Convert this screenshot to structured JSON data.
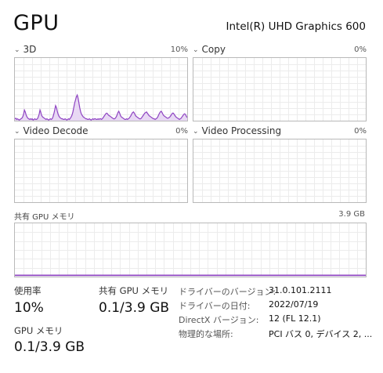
{
  "header": {
    "title": "GPU",
    "adapter_name": "Intel(R) UHD Graphics 600"
  },
  "engines": [
    {
      "label": "3D",
      "percent": "10%",
      "series": [
        3,
        4,
        2,
        3,
        2,
        1,
        2,
        3,
        4,
        6,
        10,
        17,
        14,
        9,
        6,
        4,
        3,
        2,
        3,
        2,
        3,
        1,
        2,
        3,
        2,
        2,
        3,
        6,
        10,
        17,
        13,
        8,
        6,
        5,
        4,
        3,
        2,
        3,
        2,
        1,
        2,
        3,
        2,
        3,
        6,
        11,
        17,
        24,
        21,
        15,
        10,
        7,
        5,
        4,
        3,
        3,
        2,
        2,
        3,
        2,
        1,
        2,
        3,
        2,
        4,
        6,
        9,
        14,
        21,
        28,
        33,
        38,
        41,
        36,
        28,
        20,
        14,
        10,
        8,
        6,
        5,
        4,
        3,
        3,
        2,
        2,
        3,
        2,
        1,
        2,
        3,
        2,
        3,
        3,
        2,
        2,
        3,
        2,
        3,
        3,
        2,
        3,
        5,
        7,
        9,
        11,
        12,
        11,
        9,
        8,
        7,
        6,
        5,
        4,
        3,
        3,
        4,
        6,
        9,
        13,
        15,
        12,
        8,
        6,
        5,
        4,
        3,
        2,
        2,
        3,
        2,
        3,
        4,
        6,
        8,
        11,
        13,
        14,
        12,
        9,
        7,
        6,
        5,
        4,
        3,
        3,
        4,
        6,
        8,
        10,
        12,
        13,
        14,
        12,
        10,
        8,
        7,
        6,
        5,
        4,
        3,
        3,
        2,
        3,
        4,
        6,
        9,
        12,
        14,
        15,
        13,
        10,
        8,
        7,
        6,
        5,
        4,
        4,
        5,
        6,
        8,
        10,
        12,
        12,
        10,
        8,
        6,
        5,
        4,
        3,
        2,
        3,
        4,
        6,
        8,
        10,
        11,
        10,
        7,
        5
      ]
    },
    {
      "label": "Copy",
      "percent": "0%",
      "series": []
    },
    {
      "label": "Video Decode",
      "percent": "0%",
      "series": []
    },
    {
      "label": "Video Processing",
      "percent": "0%",
      "series": []
    }
  ],
  "shared_memory": {
    "label": "共有 GPU メモリ",
    "max": "3.9 GB",
    "usage_fraction": 0.026
  },
  "stats": {
    "utilization_label": "使用率",
    "utilization_value": "10%",
    "shared_label": "共有 GPU メモリ",
    "shared_value": "0.1/3.9 GB",
    "gpu_mem_label": "GPU メモリ",
    "gpu_mem_value": "0.1/3.9 GB"
  },
  "info": [
    {
      "key": "ドライバーのバージョン:",
      "value": "31.0.101.2111"
    },
    {
      "key": "ドライバーの日付:",
      "value": "2022/07/19"
    },
    {
      "key": "DirectX バージョン:",
      "value": "12 (FL 12.1)"
    },
    {
      "key": "物理的な場所:",
      "value": "PCI バス 0, デバイス 2, ..."
    }
  ],
  "colors": {
    "accent": "#8e44c2",
    "fill": "#e8d8f4",
    "grid": "#ececec",
    "border": "#b9b9b9"
  }
}
